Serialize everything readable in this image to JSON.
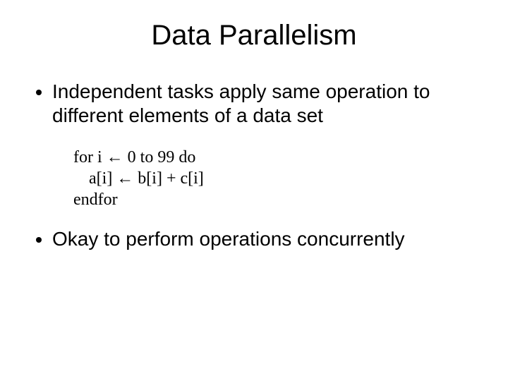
{
  "title": "Data Parallelism",
  "bullets": {
    "b1": "Independent tasks apply same operation to different elements of a data set",
    "b2": "Okay to perform operations concurrently"
  },
  "code": {
    "l1": "for i ← 0 to 99 do",
    "l2": "a[i] ← b[i] + c[i]",
    "l3": "endfor"
  }
}
